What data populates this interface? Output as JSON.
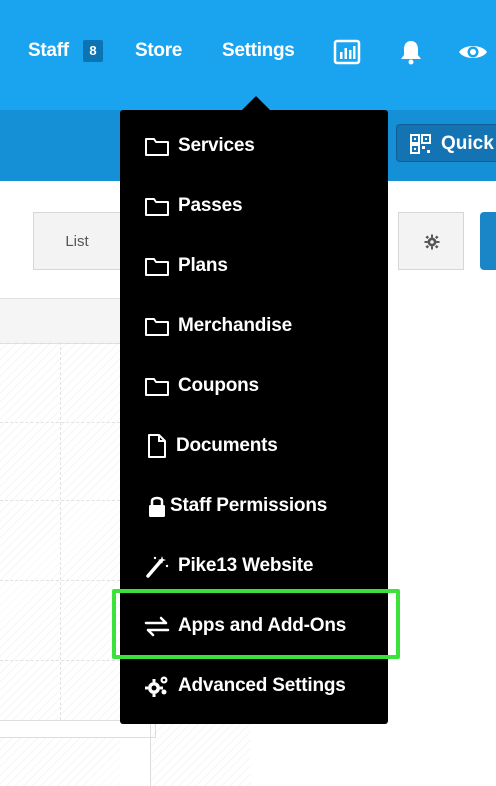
{
  "topnav": {
    "staff_label": "Staff",
    "staff_badge": "8",
    "store_label": "Store",
    "settings_label": "Settings",
    "icons": [
      "reports-icon",
      "bell-icon",
      "eye-icon"
    ]
  },
  "subbar": {
    "quick_label": "Quick"
  },
  "toolbar": {
    "list_label": "List",
    "settings_icon": "gear-icon"
  },
  "settings_menu": {
    "items": [
      {
        "label": "Services",
        "icon": "folder-icon"
      },
      {
        "label": "Passes",
        "icon": "folder-icon"
      },
      {
        "label": "Plans",
        "icon": "folder-icon"
      },
      {
        "label": "Merchandise",
        "icon": "folder-icon"
      },
      {
        "label": "Coupons",
        "icon": "folder-icon"
      },
      {
        "label": "Documents",
        "icon": "document-icon"
      },
      {
        "label": "Staff Permissions",
        "icon": "lock-icon"
      },
      {
        "label": "Pike13 Website",
        "icon": "magic-wand-icon"
      },
      {
        "label": "Apps and Add-Ons",
        "icon": "arrows-exchange-icon"
      },
      {
        "label": "Advanced Settings",
        "icon": "gears-icon"
      }
    ],
    "highlighted_item": "Apps and Add-Ons",
    "highlight_color": "#3be23b"
  },
  "colors": {
    "topbar": "#1aa3ef",
    "subbar": "#1590d6",
    "menu_bg": "#000000"
  }
}
